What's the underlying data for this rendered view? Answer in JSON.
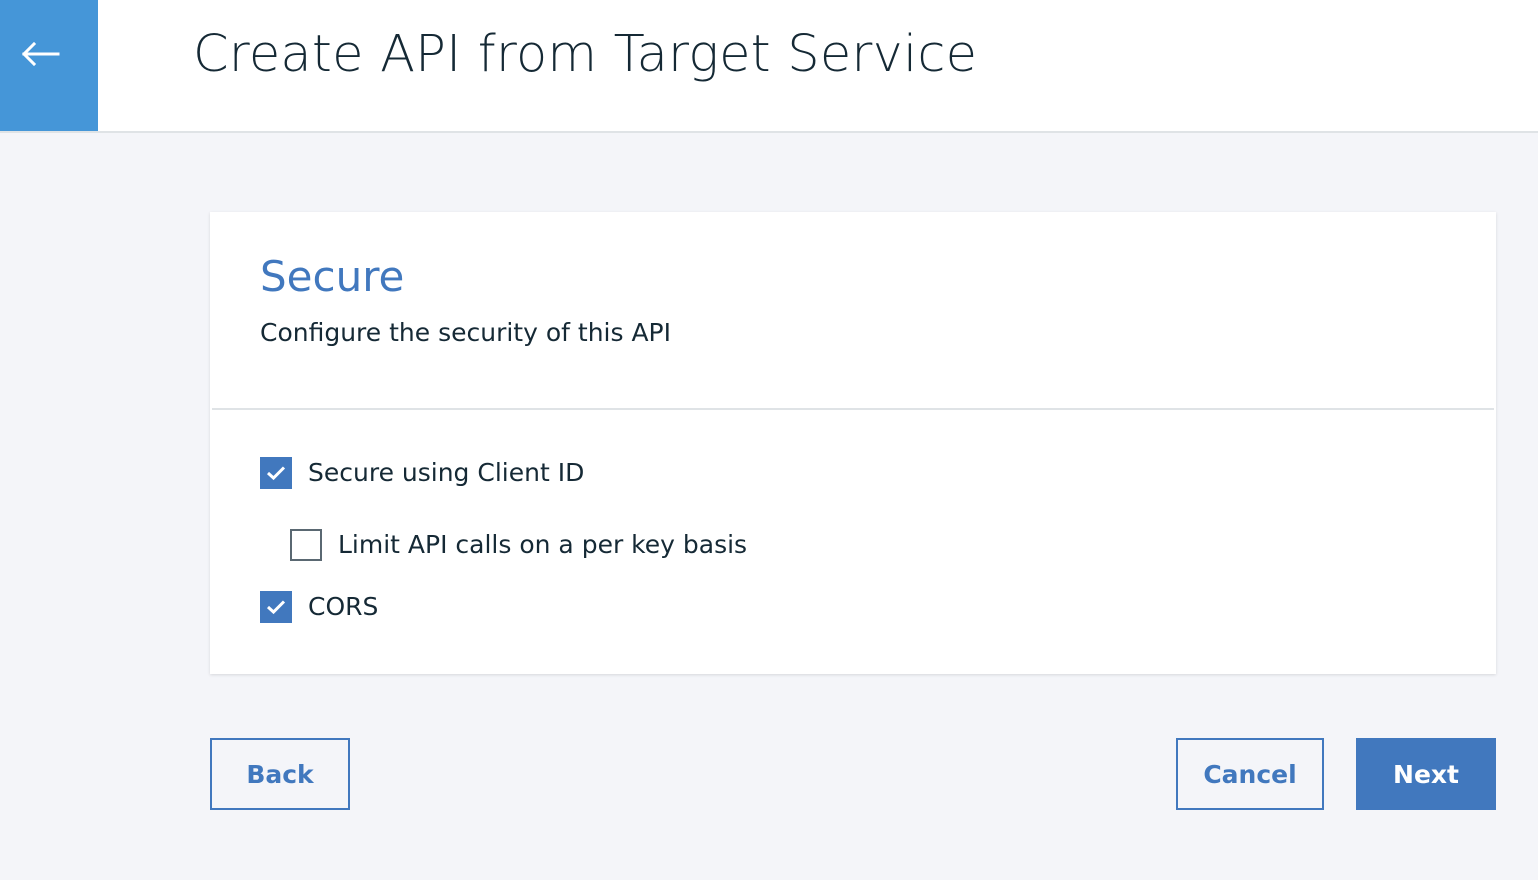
{
  "header": {
    "title": "Create API from Target Service",
    "back_icon": "arrow-left-icon",
    "accent_color": "#4596d8"
  },
  "card": {
    "title": "Secure",
    "subtitle": "Configure the security of this API",
    "options": [
      {
        "label": "Secure using Client ID",
        "checked": true
      },
      {
        "label": "Limit API calls on a per key basis",
        "checked": false
      },
      {
        "label": "CORS",
        "checked": true
      }
    ]
  },
  "footer": {
    "back_label": "Back",
    "cancel_label": "Cancel",
    "next_label": "Next"
  },
  "colors": {
    "primary": "#4178be",
    "background": "#f4f5f9",
    "text": "#152935"
  }
}
